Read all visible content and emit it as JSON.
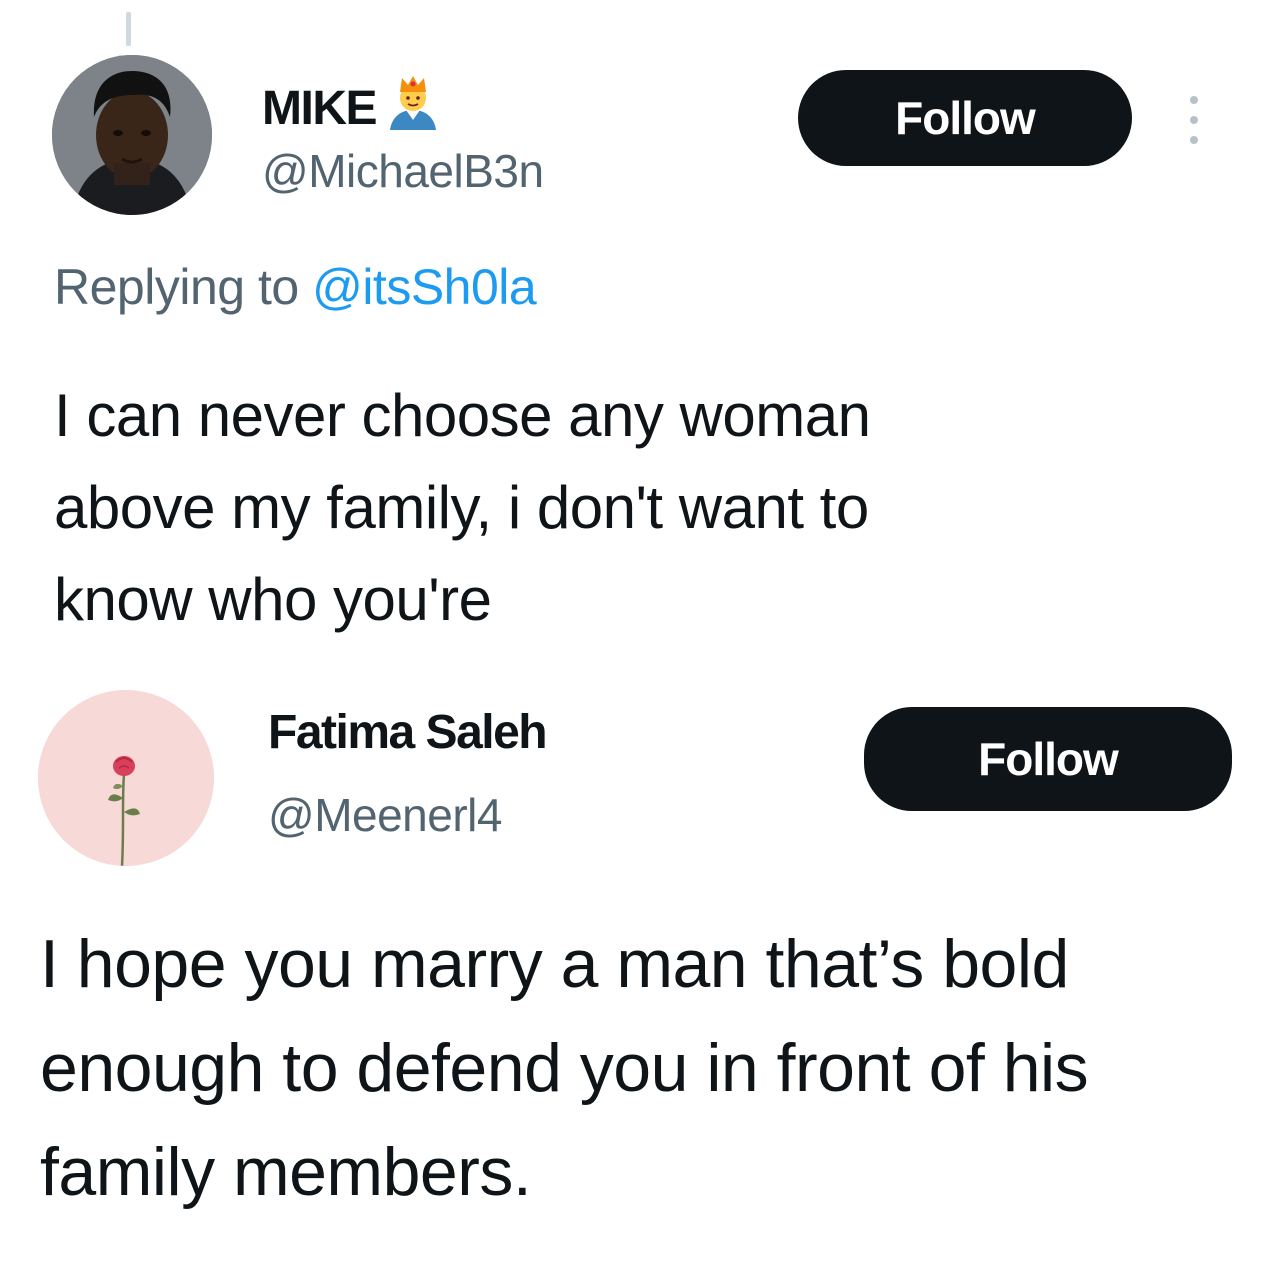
{
  "tweets": [
    {
      "display_name": "MIKE",
      "handle": "@MichaelB3n",
      "badge_icon": "man-with-crown-emoji-icon",
      "follow_label": "Follow",
      "more_icon": "more-vertical-icon",
      "replying_prefix": "Replying to",
      "replying_to": "@itsSh0la",
      "text_lines": [
        "I can never choose any woman",
        "above my family, i don't want to",
        "know who you're"
      ]
    },
    {
      "display_name": "Fatima Saleh",
      "handle": "@Meenerl4",
      "avatar_icon": "rose-icon",
      "follow_label": "Follow",
      "text_lines": [
        "I hope you marry a man that’s bold",
        "enough to defend you in front of his",
        "family members."
      ]
    }
  ],
  "colors": {
    "primary_text": "#0f1419",
    "secondary_text": "#536471",
    "link": "#1d9bf0",
    "button_bg": "#0f1419",
    "button_text": "#ffffff"
  }
}
